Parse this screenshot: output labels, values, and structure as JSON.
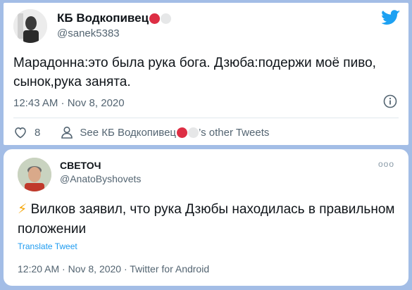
{
  "tweet1": {
    "name": "КБ Водкопивец",
    "handle": "@sanek5383",
    "text": "Марадонна:это была рука бога. Дзюба:подержи моё пиво, сынок,рука занята.",
    "timestamp": "12:43 AM · Nov 8, 2020",
    "likes": "8",
    "see_prefix": "See КБ Водкопивец",
    "see_suffix": "’s other Tweets",
    "icons": {
      "logo": "twitter-bird-icon",
      "info": "info-icon",
      "like": "heart-icon",
      "profile": "person-icon"
    },
    "colors": {
      "bird": "#1da1f2",
      "red_dot": "#dd2e44",
      "white_dot": "#e6e7e8"
    }
  },
  "tweet2": {
    "name": "СВЕТОЧ",
    "handle": "@AnatoByshovets",
    "emoji": "⚡",
    "text": "Вилков заявил, что рука Дзюбы находилась в правильном положении",
    "translate": "Translate Tweet",
    "timestamp": "12:20 AM · Nov 8, 2020 · Twitter for Android",
    "more": "ooo",
    "colors": {
      "link": "#1d9bf0"
    }
  }
}
